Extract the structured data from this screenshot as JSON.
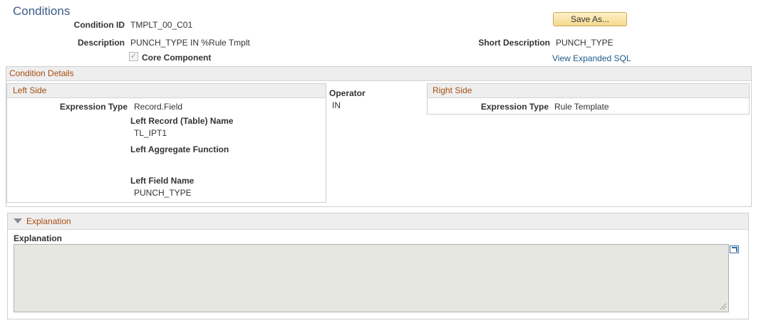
{
  "page": {
    "title": "Conditions"
  },
  "header": {
    "condition_id_label": "Condition ID",
    "condition_id_value": "TMPLT_00_C01",
    "description_label": "Description",
    "description_value": "PUNCH_TYPE IN %Rule Tmplt",
    "core_component_label": "Core Component",
    "core_component_checked": true,
    "save_as_label": "Save As...",
    "short_description_label": "Short Description",
    "short_description_value": "PUNCH_TYPE",
    "view_sql_link": "View Expanded SQL"
  },
  "condition_details": {
    "title": "Condition Details",
    "left_side": {
      "title": "Left Side",
      "expression_type_label": "Expression Type",
      "expression_type_value": "Record.Field",
      "record_name_label": "Left Record (Table) Name",
      "record_name_value": "TL_IPT1",
      "aggregate_label": "Left Aggregate Function",
      "aggregate_value": "",
      "field_name_label": "Left Field Name",
      "field_name_value": "PUNCH_TYPE"
    },
    "operator": {
      "label": "Operator",
      "value": "IN"
    },
    "right_side": {
      "title": "Right Side",
      "expression_type_label": "Expression Type",
      "expression_type_value": "Rule Template"
    }
  },
  "explanation": {
    "section_title": "Explanation",
    "field_label": "Explanation",
    "field_value": ""
  },
  "colors": {
    "title": "#3c5a87",
    "section_header": "#a64f12",
    "link": "#1f5a8c",
    "button": "#f6d98e"
  }
}
